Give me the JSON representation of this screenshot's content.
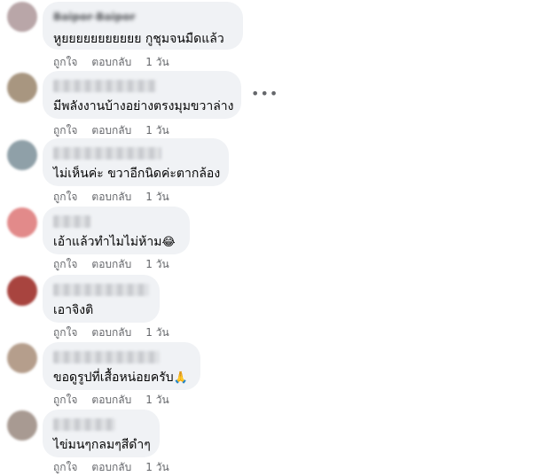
{
  "comments": [
    {
      "name": "Baipor Baipor",
      "text": "หูยยยยยยยยยยย กูชุมจนมืดแล้ว",
      "like": "ถูกใจ",
      "reply": "ตอบกลับ",
      "time": "1 วัน",
      "avatar_color": "#b9a6a8"
    },
    {
      "name": "",
      "text": "มีพลังงานบ้างอย่างตรงมุมขวาล่าง",
      "like": "ถูกใจ",
      "reply": "ตอบกลับ",
      "time": "1 วัน",
      "avatar_color": "#a89680"
    },
    {
      "name": "",
      "text": "ไม่เห็นค่ะ ขวาอีกนิดค่ะตากล้อง",
      "like": "ถูกใจ",
      "reply": "ตอบกลับ",
      "time": "1 วัน",
      "avatar_color": "#8fa0a8"
    },
    {
      "name": "",
      "text": "เอ้าแล้วทำไมไม่ห้าม",
      "emoji": "😂",
      "like": "ถูกใจ",
      "reply": "ตอบกลับ",
      "time": "1 วัน",
      "avatar_color": "#e28a8a"
    },
    {
      "name": "",
      "text": "เอาจิงติ",
      "like": "ถูกใจ",
      "reply": "ตอบกลับ",
      "time": "1 วัน",
      "avatar_color": "#a8443f"
    },
    {
      "name": "",
      "text": "ขอดูรูปที่เสื้อหน่อยครับ",
      "emoji": "🙏",
      "like": "ถูกใจ",
      "reply": "ตอบกลับ",
      "time": "1 วัน",
      "avatar_color": "#b59e8c"
    },
    {
      "name": "",
      "text": "ไข่มนๆกลมๆสีดำๆ",
      "like": "ถูกใจ",
      "reply": "ตอบกลับ",
      "time": "1 วัน",
      "avatar_color": "#a89a92"
    }
  ],
  "more_icon": "more-horizontal-icon",
  "colors": {
    "bubble": "#f0f2f5",
    "meta": "#65676b",
    "text": "#050505"
  }
}
